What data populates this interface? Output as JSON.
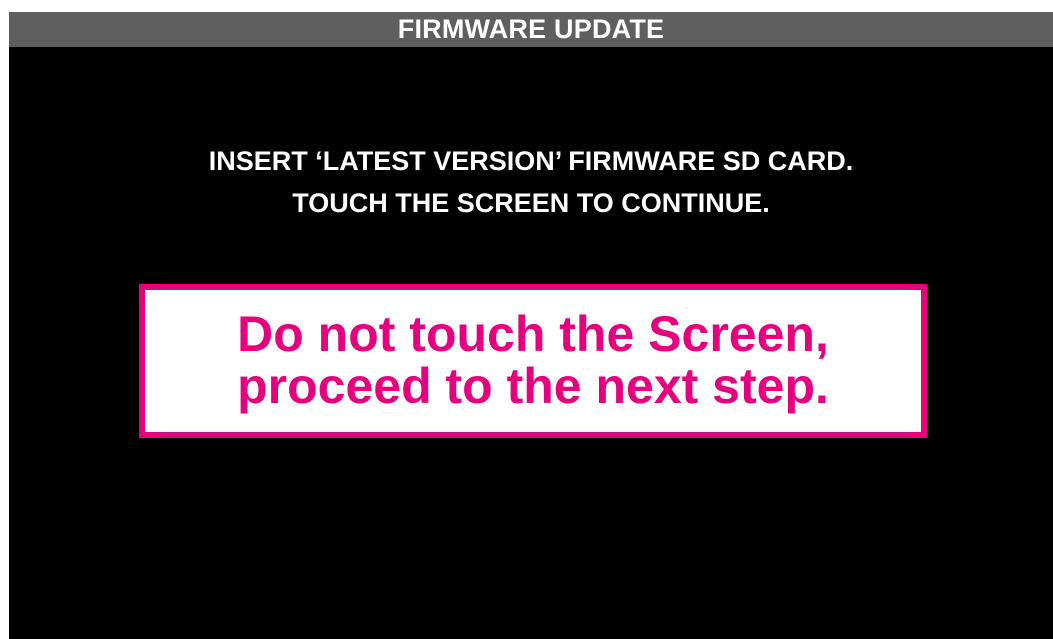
{
  "header": {
    "title": "FIRMWARE UPDATE"
  },
  "instructions": {
    "line1": "INSERT ‘LATEST VERSION’ FIRMWARE SD CARD.",
    "line2": "TOUCH THE SCREEN TO CONTINUE."
  },
  "note": {
    "line1": "Do not touch the Screen,",
    "line2": "proceed to the next step."
  },
  "colors": {
    "screen_background": "#000000",
    "title_bar": "#5f5f5f",
    "note_accent": "#e6007e",
    "text": "#ffffff"
  }
}
